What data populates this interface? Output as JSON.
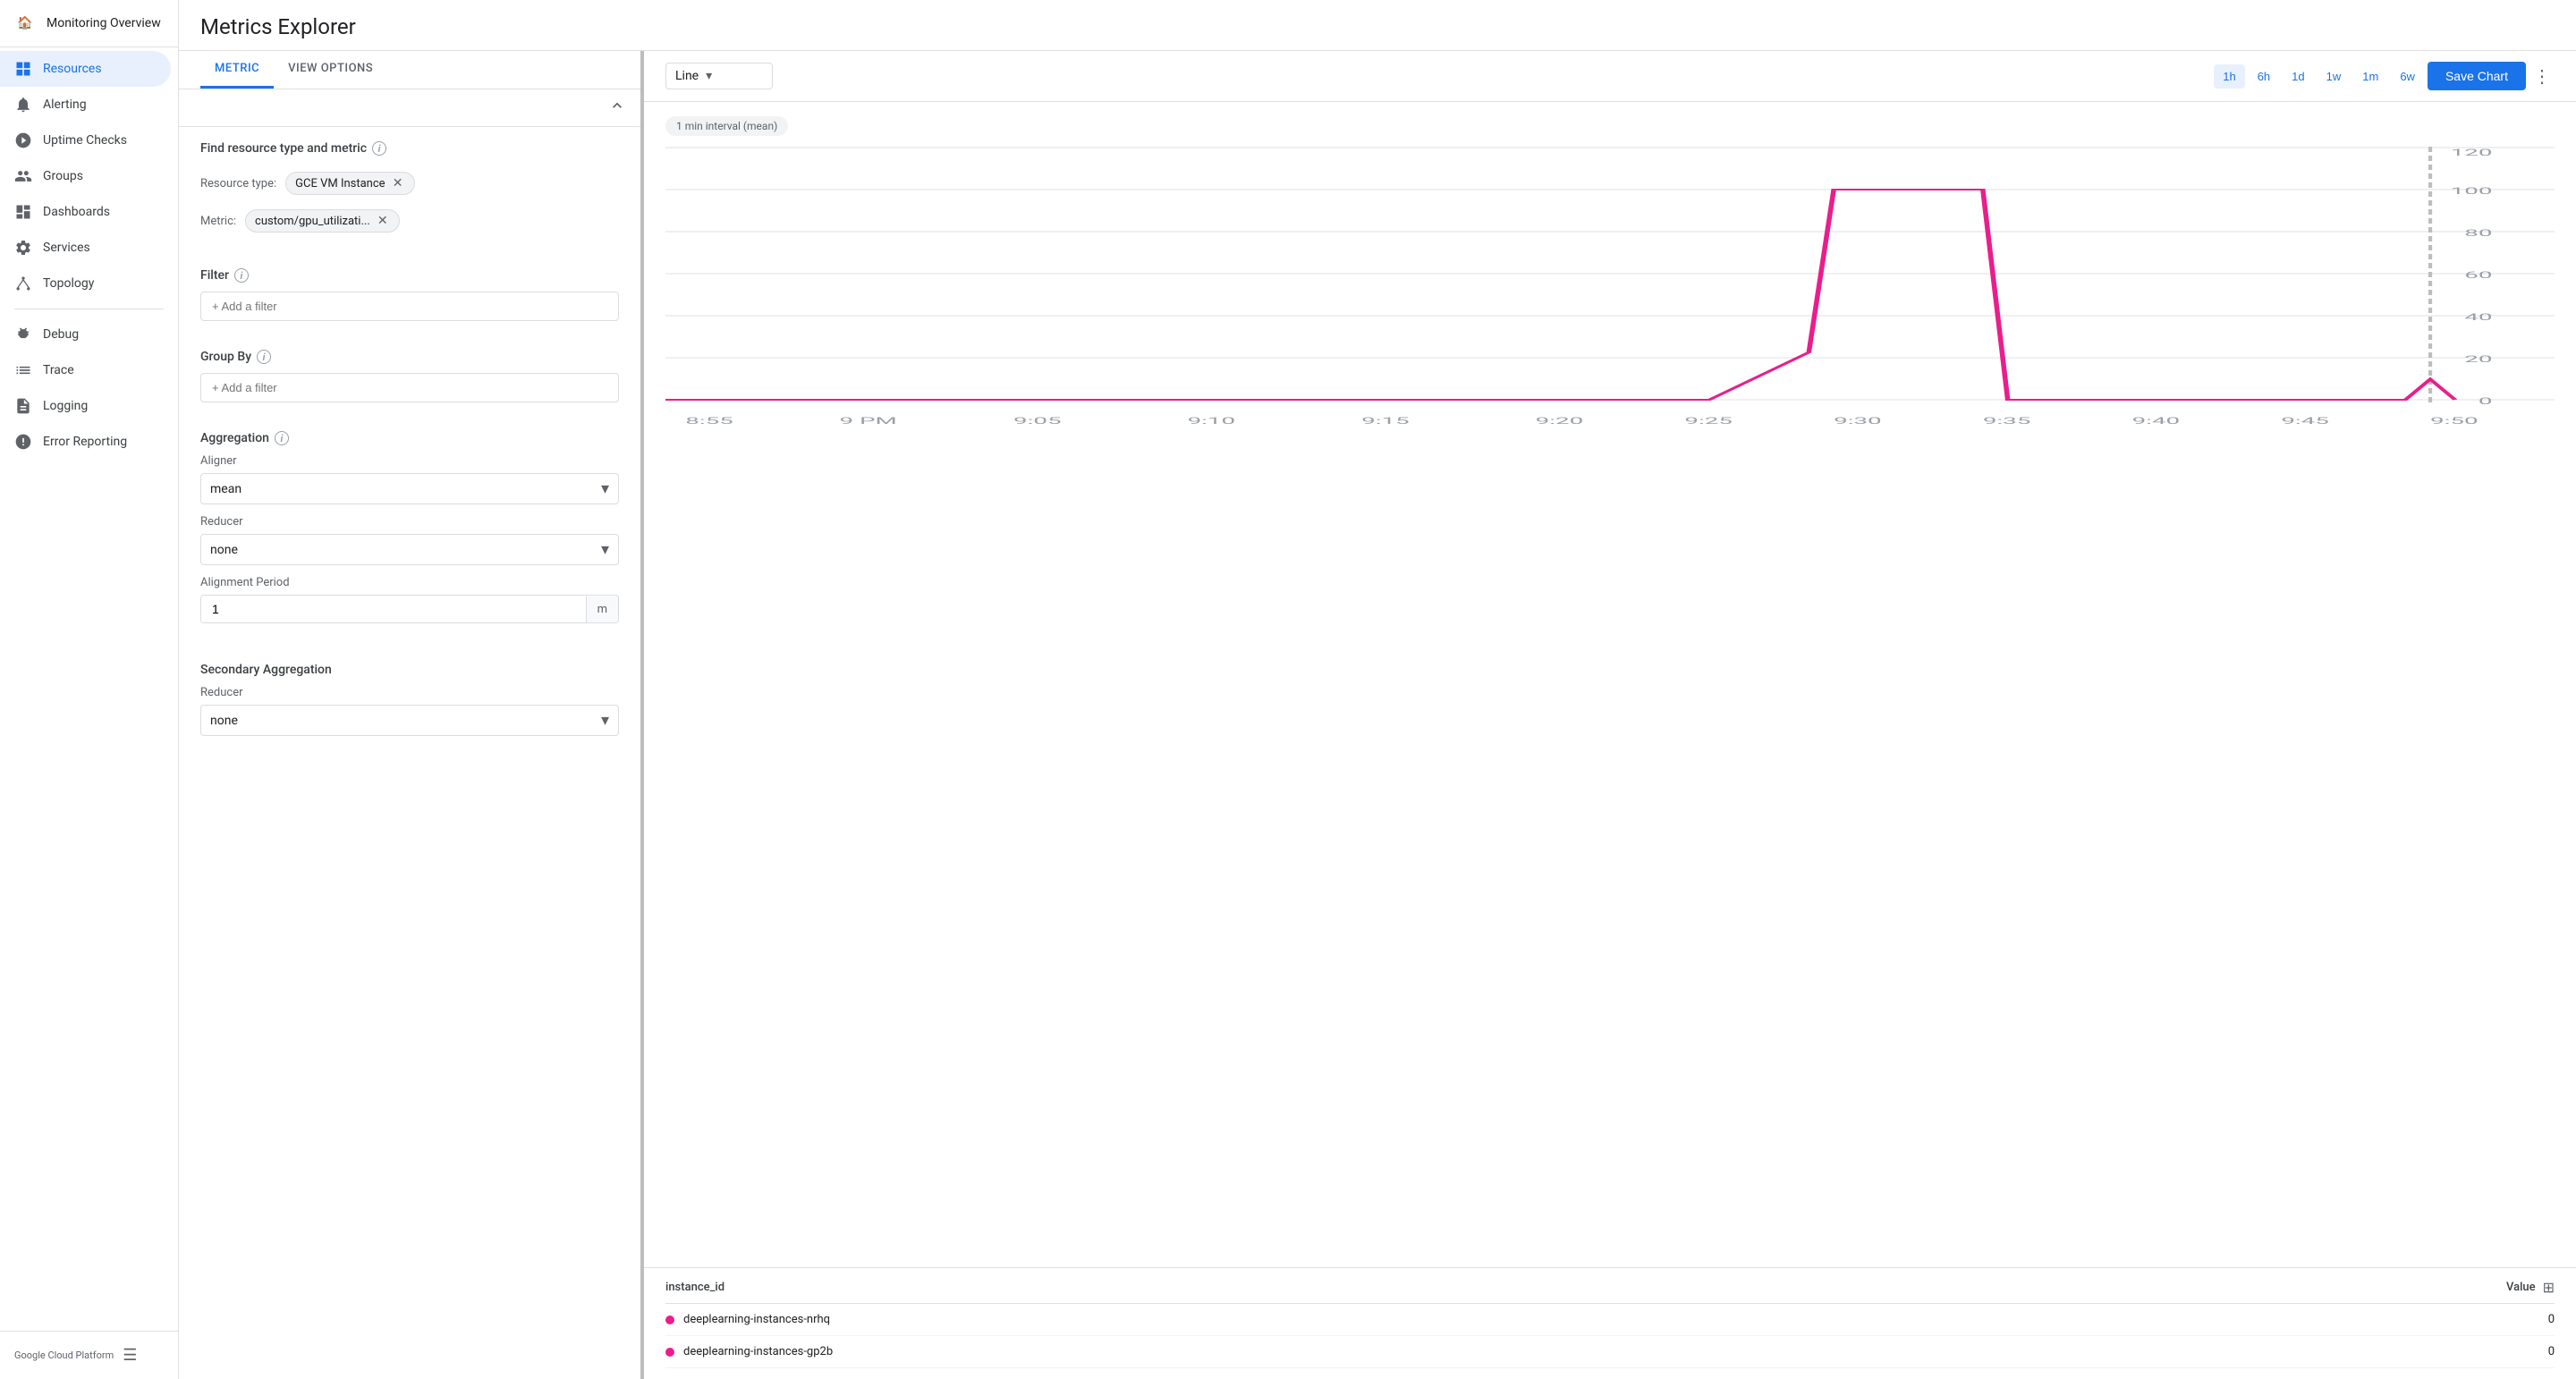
{
  "sidebar": {
    "home_icon": "⌂",
    "top_label": "Monitoring Overview",
    "items": [
      {
        "id": "resources",
        "label": "Resources",
        "icon": "⊞",
        "active": true
      },
      {
        "id": "alerting",
        "label": "Alerting",
        "icon": "🔔",
        "active": false
      },
      {
        "id": "uptime",
        "label": "Uptime Checks",
        "icon": "⏱",
        "active": false
      },
      {
        "id": "groups",
        "label": "Groups",
        "icon": "◫",
        "active": false
      },
      {
        "id": "dashboards",
        "label": "Dashboards",
        "icon": "▦",
        "active": false
      },
      {
        "id": "services",
        "label": "Services",
        "icon": "⚡",
        "active": false
      },
      {
        "id": "topology",
        "label": "Topology",
        "icon": "⛶",
        "active": false
      },
      {
        "id": "debug",
        "label": "Debug",
        "icon": "⚡",
        "active": false
      },
      {
        "id": "trace",
        "label": "Trace",
        "icon": "≡",
        "active": false
      },
      {
        "id": "logging",
        "label": "Logging",
        "icon": "☰",
        "active": false
      },
      {
        "id": "error",
        "label": "Error Reporting",
        "icon": "⚠",
        "active": false
      }
    ],
    "footer_label": "Google Cloud Platform",
    "footer_icon": "☰"
  },
  "page": {
    "title": "Metrics Explorer"
  },
  "tabs": [
    {
      "id": "metric",
      "label": "METRIC",
      "active": true
    },
    {
      "id": "view_options",
      "label": "VIEW OPTIONS",
      "active": false
    }
  ],
  "metric_panel": {
    "find_resource_label": "Find resource type and metric",
    "resource_type_label": "Resource type:",
    "resource_type_value": "GCE VM Instance",
    "metric_label": "Metric:",
    "metric_value": "custom/gpu_utilizati...",
    "filter_label": "Filter",
    "filter_placeholder": "+ Add a filter",
    "group_by_label": "Group By",
    "group_by_placeholder": "+ Add a filter",
    "aggregation_label": "Aggregation",
    "aligner_label": "Aligner",
    "aligner_value": "mean",
    "reducer_label": "Reducer",
    "reducer_value": "none",
    "alignment_period_label": "Alignment Period",
    "alignment_period_value": "1",
    "alignment_period_unit": "m",
    "secondary_aggregation_label": "Secondary Aggregation",
    "secondary_reducer_label": "Reducer",
    "secondary_reducer_value": "none"
  },
  "chart": {
    "type": "Line",
    "interval_badge": "1 min interval (mean)",
    "time_options": [
      "1h",
      "6h",
      "1d",
      "1w",
      "1m",
      "6w"
    ],
    "active_time": "1h",
    "save_label": "Save Chart",
    "y_axis": [
      0,
      20,
      40,
      60,
      80,
      100,
      120
    ],
    "x_axis": [
      "8:55",
      "9 PM",
      "9:05",
      "9:10",
      "9:15",
      "9:20",
      "9:25",
      "9:30",
      "9:35",
      "9:40",
      "9:45",
      "9:50"
    ],
    "legend": {
      "col_label": "instance_id",
      "value_label": "Value",
      "rows": [
        {
          "name": "deeplearning-instances-nrhq",
          "value": "0"
        },
        {
          "name": "deeplearning-instances-gp2b",
          "value": "0"
        }
      ]
    }
  }
}
